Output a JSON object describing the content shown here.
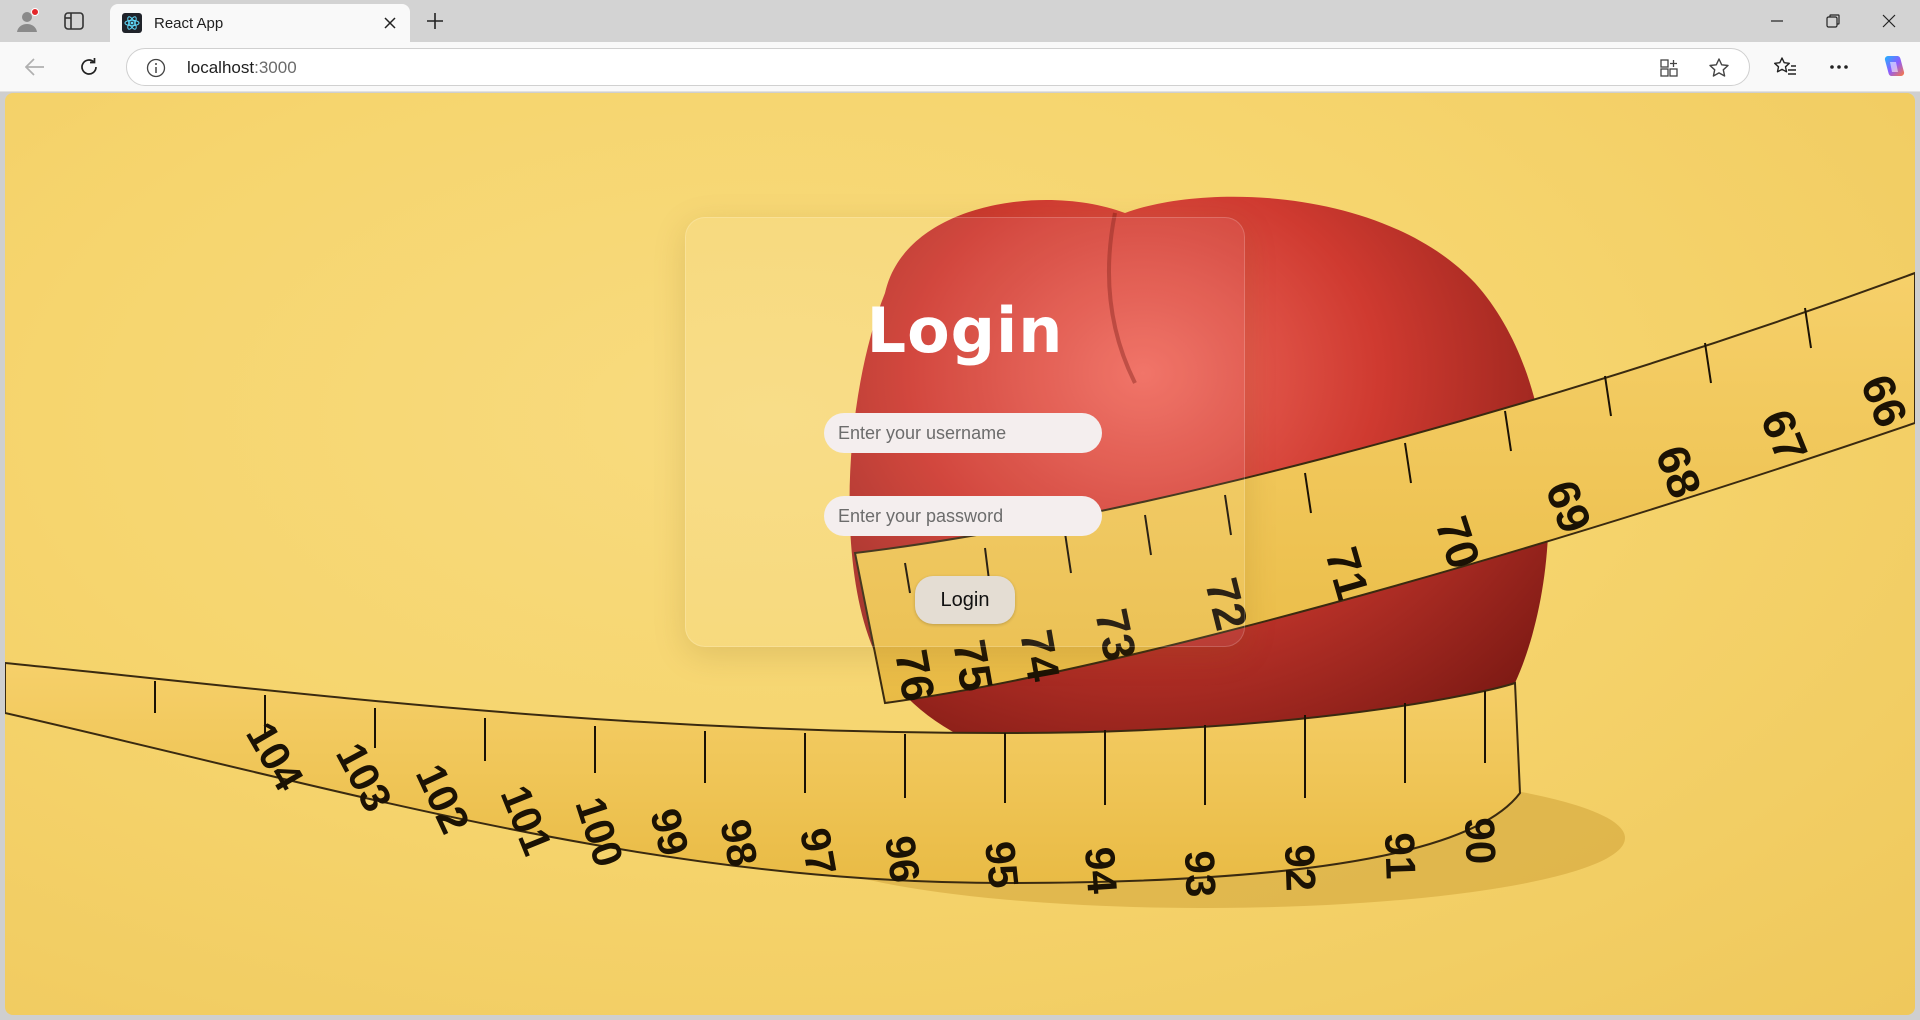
{
  "browser": {
    "tab_title": "React App",
    "url_host": "localhost",
    "url_port": ":3000",
    "icons": [
      "profile-icon",
      "tab-actions-icon",
      "react-favicon",
      "close-icon",
      "new-tab-icon",
      "minimize-icon",
      "restore-icon",
      "window-close-icon",
      "back-icon",
      "refresh-icon",
      "info-icon",
      "app-available-icon",
      "favorite-star-icon",
      "favorites-icon",
      "more-icon",
      "copilot-icon"
    ]
  },
  "login": {
    "title": "Login",
    "username_placeholder": "Enter your username",
    "password_placeholder": "Enter your password",
    "submit_label": "Login"
  },
  "background": {
    "description_colors": {
      "bg": "#f6d56e",
      "apple": "#c8302a",
      "tape": "#f2c94c"
    },
    "tape_numbers_upper": [
      "76",
      "75",
      "74",
      "73",
      "72",
      "71",
      "70",
      "69",
      "68",
      "67",
      "66"
    ],
    "tape_numbers_lower": [
      "104",
      "103",
      "102",
      "101",
      "100",
      "99",
      "98",
      "97",
      "96",
      "95",
      "94",
      "93",
      "92",
      "91",
      "90"
    ]
  }
}
